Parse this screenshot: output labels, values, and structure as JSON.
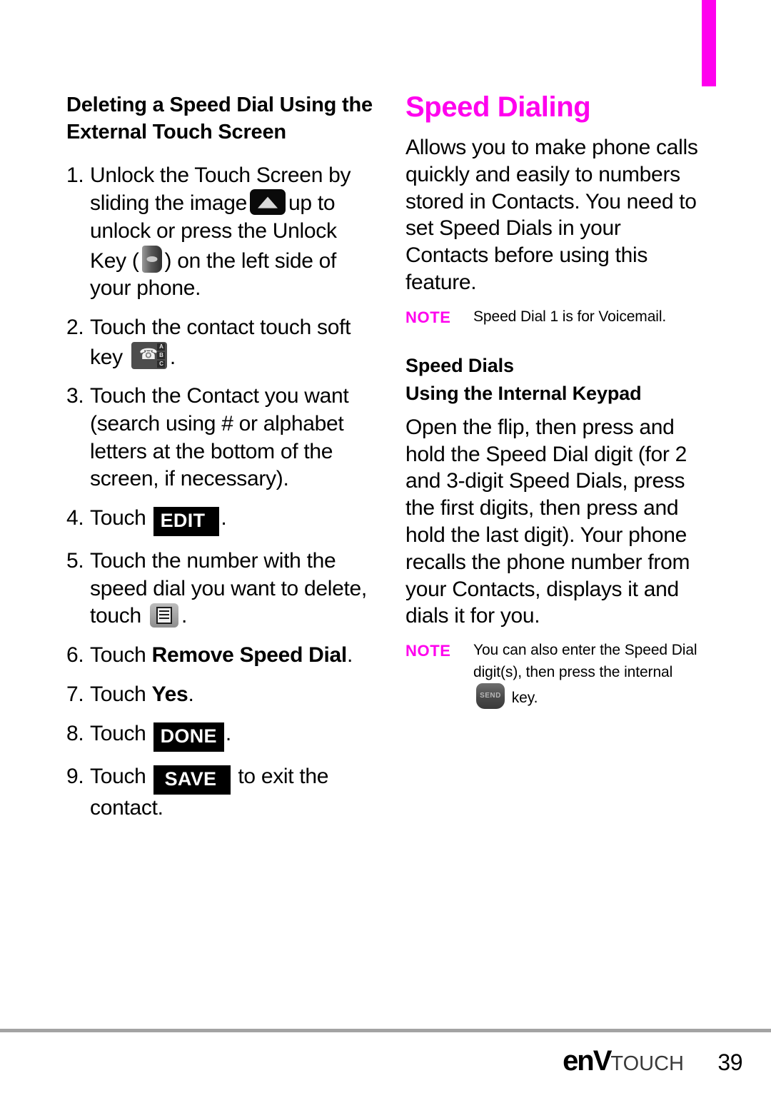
{
  "page": {
    "number": "39",
    "brand_primary": "enV",
    "brand_secondary": "TOUCH",
    "accent_color": "#ff00ee",
    "rule_color": "#a3a3a3"
  },
  "left_column": {
    "heading": "Deleting a Speed Dial Using the External Touch Screen",
    "steps": [
      {
        "num": "1.",
        "part1": "Unlock the Touch Screen by sliding the image",
        "icon1": "slide-up-arrow-icon",
        "part2": "up to unlock or press the Unlock Key (",
        "icon2": "unlock-key-icon",
        "part3": ") on the left side of your phone."
      },
      {
        "num": "2.",
        "part1": "Touch the contact touch soft key",
        "icon1": "contacts-soft-key-icon",
        "part2": "."
      },
      {
        "num": "3.",
        "part1": "Touch the Contact you want (search using # or alphabet letters at the bottom of the screen, if necessary)."
      },
      {
        "num": "4.",
        "part1": "Touch",
        "chip": "EDIT",
        "part2": "."
      },
      {
        "num": "5.",
        "part1": "Touch the number with the speed dial you want to delete, touch",
        "icon1": "options-list-key-icon",
        "part2": "."
      },
      {
        "num": "6.",
        "part1": "Touch",
        "bold": "Remove Speed Dial",
        "part2": "."
      },
      {
        "num": "7.",
        "part1": "Touch",
        "bold": "Yes",
        "part2": "."
      },
      {
        "num": "8.",
        "part1": "Touch",
        "chip": "DONE",
        "part2": "."
      },
      {
        "num": "9.",
        "part1": "Touch",
        "chip": "SAVE",
        "part2": "to exit the contact."
      }
    ]
  },
  "right_column": {
    "title": "Speed Dialing",
    "intro": "Allows you to make phone calls quickly and easily to numbers stored in Contacts. You need to set Speed Dials in your Contacts before using this feature.",
    "note1": {
      "label": "NOTE",
      "text": "Speed Dial 1 is for Voicemail."
    },
    "subheading1": "Speed Dials",
    "subheading2": "Using the Internal Keypad",
    "body": "Open the flip, then press and hold the Speed Dial digit (for 2 and 3-digit Speed Dials, press the first digits, then press and hold the last digit). Your phone recalls the phone number from your Contacts, displays it and dials it for you.",
    "note2": {
      "label": "NOTE",
      "text_part1": "You can also enter the Speed Dial digit(s), then press the internal",
      "icon": "send-key-icon",
      "text_part2": "key."
    }
  }
}
